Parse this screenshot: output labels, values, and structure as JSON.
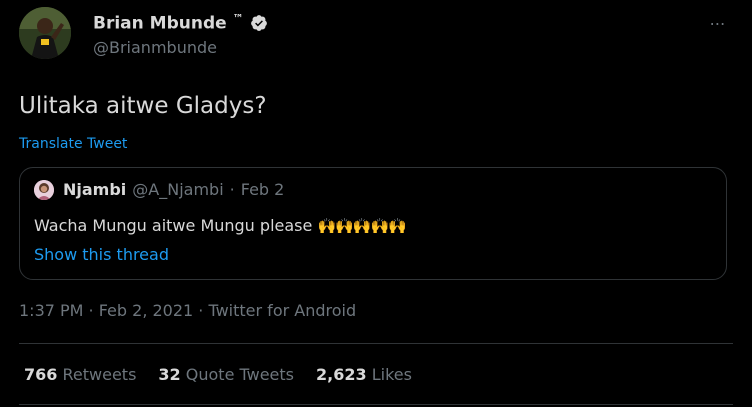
{
  "author": {
    "display_name": "Brian Mbunde",
    "tm": "™",
    "handle": "@Brianmbunde"
  },
  "more_icon": "⋯",
  "tweet": {
    "text": "Ulitaka aitwe Gladys?",
    "translate_label": "Translate Tweet"
  },
  "quoted": {
    "name": "Njambi",
    "handle": "@A_Njambi",
    "separator": "·",
    "date": "Feb 2",
    "text": "Wacha Mungu aitwe Mungu please",
    "emoji": "🙌🙌🙌🙌🙌",
    "show_thread": "Show this thread"
  },
  "meta": {
    "line": "1:37 PM · Feb 2, 2021 · Twitter for Android"
  },
  "stats": {
    "retweets_count": "766",
    "retweets_label": "Retweets",
    "quotes_count": "32",
    "quotes_label": "Quote Tweets",
    "likes_count": "2,623",
    "likes_label": "Likes"
  },
  "colors": {
    "accent": "#1d9bf0",
    "background": "#000000",
    "secondary_text": "#6e767d"
  }
}
